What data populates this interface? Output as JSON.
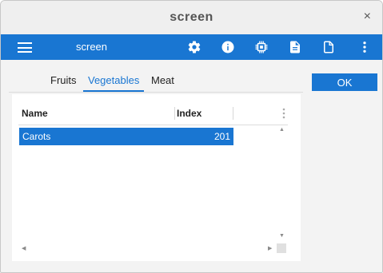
{
  "window": {
    "title": "screen",
    "close_glyph": "×"
  },
  "toolbar": {
    "app_label": "screen",
    "icons": [
      "gear-icon",
      "info-icon",
      "chip-icon",
      "document-text-icon",
      "document-icon",
      "more-vert-icon"
    ]
  },
  "tabs": [
    {
      "label": "Fruits",
      "active": false
    },
    {
      "label": "Vegetables",
      "active": true
    },
    {
      "label": "Meat",
      "active": false
    }
  ],
  "ok_button": {
    "label": "OK"
  },
  "table": {
    "columns": [
      "Name",
      "Index"
    ],
    "rows": [
      {
        "name": "Carots",
        "index": "201",
        "selected": true
      }
    ]
  },
  "colors": {
    "accent": "#1976d2",
    "titlebar": "#efefef",
    "background": "#f3f3f3"
  }
}
